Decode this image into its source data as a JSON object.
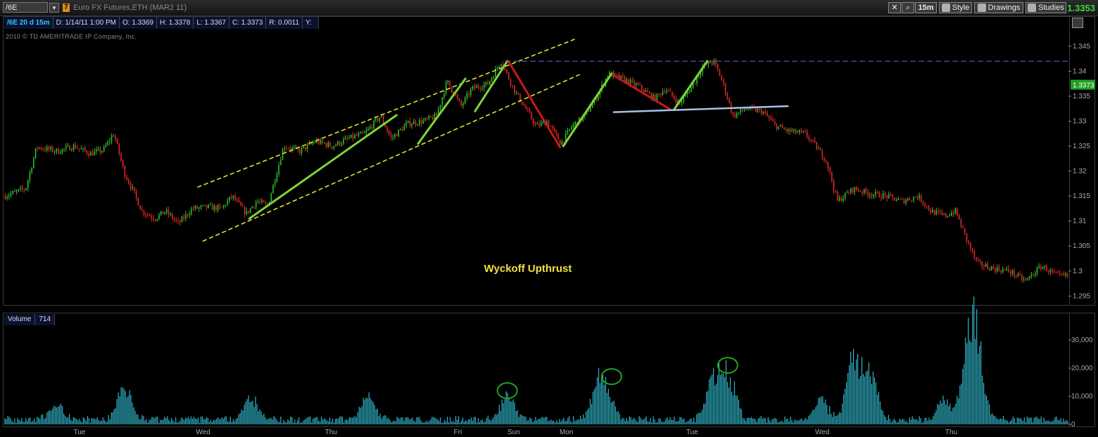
{
  "toolbar": {
    "symbol": "/6E",
    "link_number": "7",
    "instrument": "Euro FX Futures,ETH (MAR2 11)",
    "interval_button": "15m",
    "style_button": "Style",
    "drawings_button": "Drawings",
    "studies_button": "Studies",
    "last_price": "1.3353"
  },
  "infobar": {
    "symbol_period": "/6E 20 d 15m",
    "date": "D: 1/14/11 1:00 PM",
    "open": "O: 1.3369",
    "high": "H: 1.3378",
    "low": "L: 1.3367",
    "close": "C: 1.3373",
    "range": "R: 0.0011",
    "y": "Y:"
  },
  "copyright": "2010 © TD AMERITRADE IP Company, Inc.",
  "annotation": "Wyckoff Upthrust",
  "volume_panel": {
    "label": "Volume",
    "value": "714"
  },
  "colors": {
    "up": "#2fbf2f",
    "down": "#e02828",
    "volume": "#2fb5c8",
    "trend_green": "#7cd43a",
    "trend_red": "#c81818",
    "channel": "#e8e030",
    "support": "#a8c0e8",
    "resistance": "#6a6acf"
  },
  "chart_data": [
    {
      "type": "candlestick",
      "title": "",
      "x_labels": [
        {
          "x": 0.4,
          "label": "Tue"
        },
        {
          "x": 1.55,
          "label": "Wed"
        },
        {
          "x": 2.74,
          "label": "Thu"
        },
        {
          "x": 3.92,
          "label": "Fri"
        },
        {
          "x": 4.44,
          "label": "Sun"
        },
        {
          "x": 4.93,
          "label": "Mon"
        },
        {
          "x": 6.1,
          "label": "Tue"
        },
        {
          "x": 7.31,
          "label": "Wed"
        },
        {
          "x": 8.51,
          "label": "Thu"
        }
      ],
      "xlim": [
        -0.3,
        9.6
      ],
      "ylim": [
        1.2935,
        1.3475
      ],
      "y_ticks": [
        1.295,
        1.3,
        1.305,
        1.31,
        1.315,
        1.32,
        1.325,
        1.33,
        1.335,
        1.34,
        1.345
      ],
      "y_tick_labels": [
        "1.295",
        "1.3",
        "1.305",
        "1.31",
        "1.315",
        "1.32",
        "1.325",
        "1.33",
        "1.335",
        "1.34",
        "1.345"
      ],
      "current_price": 1.3373,
      "current_price_label": "1.3373",
      "price_path": [
        [
          -0.3,
          1.315
        ],
        [
          -0.1,
          1.3165
        ],
        [
          0.0,
          1.3248
        ],
        [
          0.2,
          1.324
        ],
        [
          0.35,
          1.325
        ],
        [
          0.5,
          1.3235
        ],
        [
          0.62,
          1.3242
        ],
        [
          0.72,
          1.3275
        ],
        [
          0.82,
          1.3195
        ],
        [
          0.9,
          1.316
        ],
        [
          0.98,
          1.312
        ],
        [
          1.1,
          1.3105
        ],
        [
          1.2,
          1.312
        ],
        [
          1.32,
          1.3095
        ],
        [
          1.45,
          1.3125
        ],
        [
          1.6,
          1.3128
        ],
        [
          1.72,
          1.3125
        ],
        [
          1.82,
          1.315
        ],
        [
          1.95,
          1.3115
        ],
        [
          2.05,
          1.314
        ],
        [
          2.15,
          1.313
        ],
        [
          2.3,
          1.325
        ],
        [
          2.45,
          1.324
        ],
        [
          2.6,
          1.326
        ],
        [
          2.75,
          1.325
        ],
        [
          2.9,
          1.3265
        ],
        [
          3.05,
          1.3275
        ],
        [
          3.2,
          1.331
        ],
        [
          3.3,
          1.3265
        ],
        [
          3.45,
          1.3295
        ],
        [
          3.6,
          1.33
        ],
        [
          3.72,
          1.331
        ],
        [
          3.82,
          1.338
        ],
        [
          3.95,
          1.333
        ],
        [
          4.05,
          1.3365
        ],
        [
          4.2,
          1.3375
        ],
        [
          4.32,
          1.342
        ],
        [
          4.45,
          1.336
        ],
        [
          4.55,
          1.3325
        ],
        [
          4.65,
          1.329
        ],
        [
          4.75,
          1.33
        ],
        [
          4.88,
          1.3255
        ],
        [
          4.98,
          1.329
        ],
        [
          5.1,
          1.331
        ],
        [
          5.2,
          1.3345
        ],
        [
          5.32,
          1.3395
        ],
        [
          5.45,
          1.3385
        ],
        [
          5.6,
          1.337
        ],
        [
          5.75,
          1.3345
        ],
        [
          5.85,
          1.3365
        ],
        [
          5.98,
          1.3335
        ],
        [
          6.1,
          1.337
        ],
        [
          6.2,
          1.341
        ],
        [
          6.3,
          1.342
        ],
        [
          6.38,
          1.338
        ],
        [
          6.48,
          1.331
        ],
        [
          6.6,
          1.3325
        ],
        [
          6.75,
          1.332
        ],
        [
          6.88,
          1.329
        ],
        [
          7.0,
          1.328
        ],
        [
          7.15,
          1.3275
        ],
        [
          7.25,
          1.325
        ],
        [
          7.35,
          1.322
        ],
        [
          7.45,
          1.314
        ],
        [
          7.6,
          1.3165
        ],
        [
          7.75,
          1.3155
        ],
        [
          7.9,
          1.315
        ],
        [
          8.05,
          1.314
        ],
        [
          8.2,
          1.315
        ],
        [
          8.32,
          1.312
        ],
        [
          8.45,
          1.311
        ],
        [
          8.55,
          1.312
        ],
        [
          8.65,
          1.3065
        ],
        [
          8.75,
          1.3015
        ],
        [
          8.9,
          1.3005
        ],
        [
          9.05,
          1.3
        ],
        [
          9.2,
          1.298
        ],
        [
          9.35,
          1.301
        ],
        [
          9.5,
          1.299
        ]
      ],
      "trend_lines": [
        {
          "color": "channel",
          "dashed": true,
          "from": [
            1.5,
            1.3168
          ],
          "to": [
            5.03,
            1.3466
          ]
        },
        {
          "color": "channel",
          "dashed": true,
          "from": [
            1.55,
            1.306
          ],
          "to": [
            5.05,
            1.3393
          ]
        },
        {
          "color": "trend_green",
          "dashed": false,
          "from": [
            1.98,
            1.3105
          ],
          "to": [
            3.35,
            1.3312
          ]
        },
        {
          "color": "trend_green",
          "dashed": false,
          "from": [
            3.55,
            1.3255
          ],
          "to": [
            3.99,
            1.3385
          ]
        },
        {
          "color": "trend_green",
          "dashed": false,
          "from": [
            4.08,
            1.332
          ],
          "to": [
            4.38,
            1.342
          ]
        },
        {
          "color": "trend_red",
          "dashed": false,
          "from": [
            4.39,
            1.342
          ],
          "to": [
            4.87,
            1.3248
          ]
        },
        {
          "color": "trend_green",
          "dashed": false,
          "from": [
            4.9,
            1.325
          ],
          "to": [
            5.35,
            1.3395
          ]
        },
        {
          "color": "trend_red",
          "dashed": false,
          "from": [
            5.36,
            1.3393
          ],
          "to": [
            5.9,
            1.3323
          ]
        },
        {
          "color": "trend_green",
          "dashed": false,
          "from": [
            5.93,
            1.3323
          ],
          "to": [
            6.24,
            1.342
          ]
        },
        {
          "color": "support",
          "dashed": false,
          "width": 2.5,
          "from": [
            5.37,
            1.3318
          ],
          "to": [
            6.99,
            1.333
          ]
        },
        {
          "color": "resistance",
          "dashed": true,
          "from": [
            4.36,
            1.342
          ],
          "to": [
            9.6,
            1.342
          ]
        }
      ]
    },
    {
      "type": "bar",
      "title": "Volume",
      "ylim": [
        0,
        34000
      ],
      "y_ticks": [
        0,
        10000,
        20000,
        30000
      ],
      "y_tick_labels": [
        "0",
        "10,000",
        "20,000",
        "30,000"
      ],
      "peaks": [
        {
          "x": 0.18,
          "value": 6000
        },
        {
          "x": 0.82,
          "value": 14500
        },
        {
          "x": 2.0,
          "value": 9500
        },
        {
          "x": 3.08,
          "value": 9000
        },
        {
          "x": 4.38,
          "value": 11000
        },
        {
          "x": 5.23,
          "value": 16500
        },
        {
          "x": 5.33,
          "value": 7000
        },
        {
          "x": 6.3,
          "value": 18000
        },
        {
          "x": 6.44,
          "value": 20000
        },
        {
          "x": 7.3,
          "value": 9000
        },
        {
          "x": 7.6,
          "value": 30000
        },
        {
          "x": 7.76,
          "value": 19000
        },
        {
          "x": 8.45,
          "value": 9000
        },
        {
          "x": 8.68,
          "value": 32000
        },
        {
          "x": 8.75,
          "value": 23000
        }
      ],
      "circled": [
        {
          "x": 4.38,
          "value": 12000
        },
        {
          "x": 5.35,
          "value": 17000
        },
        {
          "x": 6.43,
          "value": 21000
        }
      ]
    }
  ]
}
